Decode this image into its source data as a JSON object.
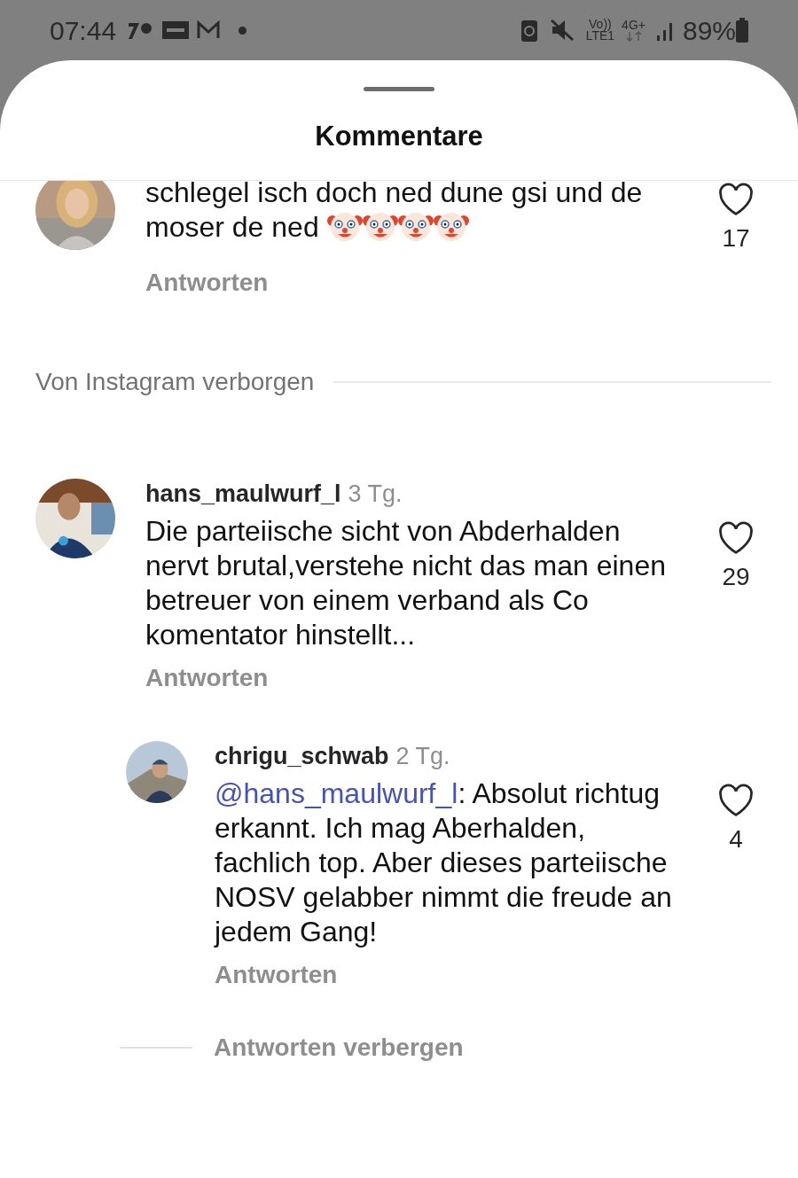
{
  "status_bar": {
    "time": "07:44",
    "network_top": "Vo))",
    "network_bottom": "LTE1",
    "data_type": "4G+",
    "battery": "89%"
  },
  "sheet": {
    "title": "Kommentare"
  },
  "comments": [
    {
      "kind": "comment",
      "text": "schlegel isch doch ned dune gsi und de moser de ned",
      "likes": "17",
      "reply_label": "Antworten"
    },
    {
      "kind": "separator",
      "text": "Von Instagram verborgen"
    },
    {
      "kind": "comment",
      "username": "hans_maulwurf_l",
      "time": "3 Tg.",
      "text": "Die parteiische sicht von Abderhalden nervt brutal,verstehe nicht das man einen betreuer von einem verband als Co komentator hinstellt...",
      "likes": "29",
      "reply_label": "Antworten"
    },
    {
      "kind": "reply",
      "username": "chrigu_schwab",
      "time": "2 Tg.",
      "mention": "@hans_maulwurf_l",
      "text": ": Absolut richtug erkannt. Ich mag Aberhalden, fachlich top. Aber dieses parteiische NOSV gelabber nimmt die freude an jedem Gang!",
      "likes": "4",
      "reply_label": "Antworten"
    },
    {
      "kind": "hide_replies",
      "text": "Antworten verbergen"
    }
  ]
}
